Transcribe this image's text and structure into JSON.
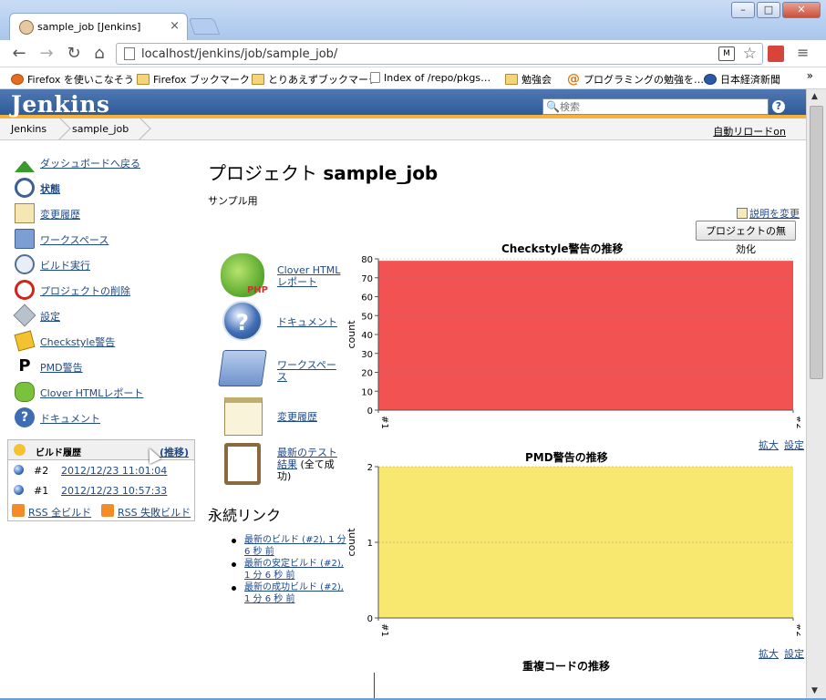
{
  "browser": {
    "tab_title": "sample_job [Jenkins]",
    "url": "localhost/jenkins/job/sample_job/",
    "bookmarks": [
      "Firefox を使いこなそう",
      "Firefox ブックマーク",
      "とりあえずブックマーク",
      "Index of /repo/pkgs…",
      "勉強会",
      "プログラミングの勉強を…",
      "日本経済新聞"
    ]
  },
  "header": {
    "logo": "Jenkins",
    "search_placeholder": "検索"
  },
  "breadcrumbs": [
    "Jenkins",
    "sample_job"
  ],
  "auto_refresh": "自動リロードon",
  "sidebar": {
    "tasks": [
      {
        "label": "ダッシュボードへ戻る",
        "icon": "up-arrow-icon"
      },
      {
        "label": "状態",
        "icon": "search-icon"
      },
      {
        "label": "変更履歴",
        "icon": "notepad-icon"
      },
      {
        "label": "ワークスペース",
        "icon": "folder-icon"
      },
      {
        "label": "ビルド実行",
        "icon": "build-clock-icon"
      },
      {
        "label": "プロジェクトの削除",
        "icon": "no-entry-icon"
      },
      {
        "label": "設定",
        "icon": "tools-icon"
      },
      {
        "label": "Checkstyle警告",
        "icon": "checkstyle-icon"
      },
      {
        "label": "PMD警告",
        "icon": "pmd-icon"
      },
      {
        "label": "Clover HTMLレポート",
        "icon": "clover-icon"
      },
      {
        "label": "ドキュメント",
        "icon": "help-icon"
      }
    ],
    "build_history": {
      "title": "ビルド履歴",
      "trend": "(推移)",
      "builds": [
        {
          "number": "#2",
          "date": "2012/12/23 11:01:04"
        },
        {
          "number": "#1",
          "date": "2012/12/23 10:57:33"
        }
      ],
      "rss_all": "RSS 全ビルド",
      "rss_failed": "RSS 失敗ビルド"
    }
  },
  "main": {
    "title_prefix": "プロジェクト",
    "title_name": "sample_job",
    "description": "サンプル用",
    "edit_description": "説明を変更",
    "disable_button": "プロジェクトの無効化",
    "links": [
      {
        "label": "Clover HTMLレポート"
      },
      {
        "label": "ドキュメント"
      },
      {
        "label": "ワークスペース"
      },
      {
        "label": "変更履歴"
      },
      {
        "label": "最新のテスト結果",
        "suffix": "(全て成功)"
      }
    ],
    "permalinks_title": "永続リンク",
    "permalinks": [
      "最新のビルド (#2), 1 分 6 秒 前",
      "最新の安定ビルド (#2), 1 分 6 秒 前",
      "最新の成功ビルド (#2), 1 分 6 秒 前"
    ],
    "chart_links": {
      "zoom": "拡大",
      "config": "設定"
    },
    "third_chart_title": "重複コードの推移"
  },
  "chart_data": [
    {
      "type": "area",
      "title": "Checkstyle警告の推移",
      "ylabel": "count",
      "x": [
        "#1",
        "#2"
      ],
      "values": [
        79,
        79
      ],
      "ylim": [
        0,
        80
      ],
      "yticks": [
        0,
        10,
        20,
        30,
        40,
        50,
        60,
        70,
        80
      ],
      "color": "#f25252",
      "grid": true
    },
    {
      "type": "area",
      "title": "PMD警告の推移",
      "ylabel": "count",
      "x": [
        "#1",
        "#2"
      ],
      "values": [
        2,
        2
      ],
      "ylim": [
        0,
        2
      ],
      "yticks": [
        0,
        1,
        2
      ],
      "color": "#f9e86f",
      "grid": true
    }
  ]
}
